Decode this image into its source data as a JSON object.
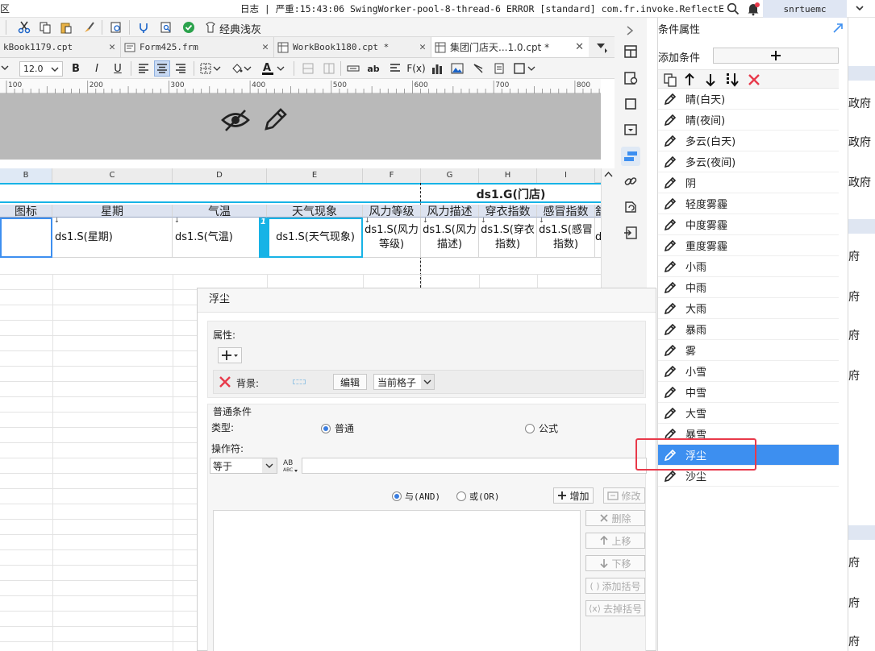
{
  "titlebar": {
    "left_label": "区",
    "log_text": "日志 | 严重:15:43:06 SwingWorker-pool-8-thread-6 ERROR [standard] com.fr.invoke.ReflectException:...",
    "user": "snrtuemc"
  },
  "toolbar1": {
    "theme_label": "经典浅灰"
  },
  "tabs": [
    {
      "label": "kBook1179.cpt"
    },
    {
      "label": "Form425.frm"
    },
    {
      "label": "WorkBook1180.cpt *"
    },
    {
      "label": "集团门店天...1.0.cpt *"
    }
  ],
  "format": {
    "font_size": "12.0"
  },
  "ruler": {
    "ticks": [
      "100",
      "200",
      "300",
      "400",
      "500",
      "600",
      "700",
      "800"
    ]
  },
  "columns": [
    "B",
    "C",
    "D",
    "E",
    "F",
    "G",
    "H",
    "I"
  ],
  "sheet": {
    "group_header": "ds1.G(门店)",
    "headers": [
      "图标",
      "星期",
      "气温",
      "天气现象",
      "风力等级",
      "风力描述",
      "穿衣指数",
      "感冒指数",
      "舒"
    ],
    "cells": [
      "ds1.S(星期)",
      "ds1.S(气温)",
      "ds1.S(天气现象)",
      "ds1.S(风力等级)",
      "ds1.S(风力描述)",
      "ds1.S(穿衣指数)",
      "ds1.S(感冒指数)",
      "d"
    ],
    "cell_marker": "1"
  },
  "dialog": {
    "title": "浮尘",
    "properties_label": "属性:",
    "background_label": "背景:",
    "edit_label": "编辑",
    "scope_value": "当前格子",
    "normal_condition_label": "普通条件",
    "type_label": "类型:",
    "type_normal": "普通",
    "type_formula": "公式",
    "operator_label": "操作符:",
    "operator_value": "等于",
    "and_label": "与(AND)",
    "or_label": "或(OR)",
    "add_label": "增加",
    "modify_label": "修改",
    "delete_label": "删除",
    "move_up_label": "上移",
    "move_down_label": "下移",
    "add_bracket_label": "添加括号",
    "remove_bracket_label": "去掉括号"
  },
  "right_panel": {
    "title": "条件属性",
    "add_condition_label": "添加条件",
    "conditions": [
      "晴(白天)",
      "晴(夜间)",
      "多云(白天)",
      "多云(夜间)",
      "阴",
      "轻度雾霾",
      "中度雾霾",
      "重度雾霾",
      "小雨",
      "中雨",
      "大雨",
      "暴雨",
      "雾",
      "小雪",
      "中雪",
      "大雪",
      "暴雪",
      "浮尘",
      "沙尘"
    ],
    "selected": "浮尘"
  },
  "far_right": {
    "items": [
      "政府",
      "政府",
      "政府",
      "府",
      "府",
      "府",
      "府",
      "府",
      "府",
      "府"
    ]
  },
  "colors": {
    "selection_blue": "#3d8ff0",
    "highlight_red": "#e8394a",
    "header_fill": "#dde3f0",
    "accent_cyan": "#17b3e6"
  }
}
